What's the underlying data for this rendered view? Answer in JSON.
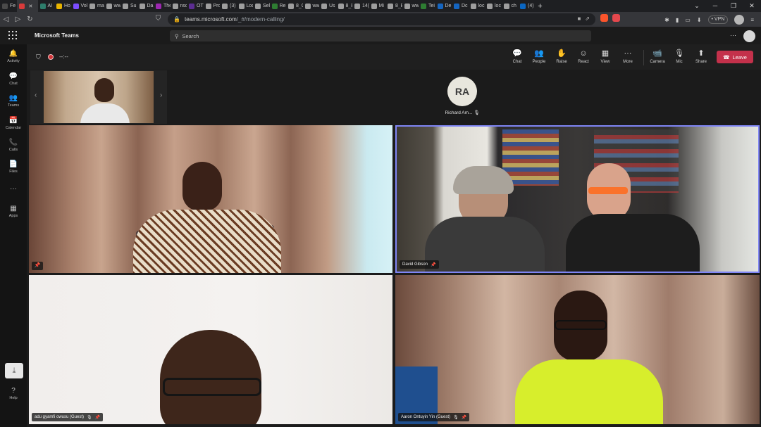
{
  "browser": {
    "tabs": [
      {
        "label": "Fe",
        "color": "#4a4a4a"
      },
      {
        "label": "",
        "color": "#d83b3b",
        "active": true
      },
      {
        "label": "AI",
        "color": "#2e7d6b"
      },
      {
        "label": "Ho",
        "color": "#e8b400"
      },
      {
        "label": "Vol",
        "color": "#7c4dff"
      },
      {
        "label": "ma",
        "color": "#9e9e9e"
      },
      {
        "label": "ww",
        "color": "#9e9e9e"
      },
      {
        "label": "Su",
        "color": "#9e9e9e"
      },
      {
        "label": "Da",
        "color": "#9e9e9e"
      },
      {
        "label": "The",
        "color": "#9c27b0"
      },
      {
        "label": "nsc",
        "color": "#9e9e9e"
      },
      {
        "label": "OT",
        "color": "#5c2d91"
      },
      {
        "label": "Pro",
        "color": "#9e9e9e"
      },
      {
        "label": "(3)",
        "color": "#9e9e9e"
      },
      {
        "label": "Loc",
        "color": "#9e9e9e"
      },
      {
        "label": "Sel",
        "color": "#9e9e9e"
      },
      {
        "label": "Rel",
        "color": "#2e7d32"
      },
      {
        "label": "8_C",
        "color": "#9e9e9e"
      },
      {
        "label": "ww",
        "color": "#9e9e9e"
      },
      {
        "label": "Us",
        "color": "#9e9e9e"
      },
      {
        "label": "8_E",
        "color": "#9e9e9e"
      },
      {
        "label": "14(",
        "color": "#9e9e9e"
      },
      {
        "label": "Mi",
        "color": "#9e9e9e"
      },
      {
        "label": "8_E",
        "color": "#9e9e9e"
      },
      {
        "label": "ww",
        "color": "#9e9e9e"
      },
      {
        "label": "Tei",
        "color": "#2e7d32"
      },
      {
        "label": "De",
        "color": "#1565c0"
      },
      {
        "label": "Dc",
        "color": "#1565c0"
      },
      {
        "label": "loc",
        "color": "#9e9e9e"
      },
      {
        "label": "loc",
        "color": "#9e9e9e"
      },
      {
        "label": "ch",
        "color": "#9e9e9e"
      },
      {
        "label": "(4)",
        "color": "#0a66c2"
      }
    ],
    "new_tab": "+",
    "window_controls": [
      "⌄",
      "─",
      "❐",
      "✕"
    ],
    "url_host": "teams.microsoft.com",
    "url_path": "/_#/modern-calling/",
    "vpn_label": "• VPN"
  },
  "teams": {
    "app_name": "Microsoft Teams",
    "search_placeholder": "Search",
    "more": "···"
  },
  "rail": [
    {
      "name": "activity",
      "icon": "🔔",
      "label": "Activity"
    },
    {
      "name": "chat",
      "icon": "💬",
      "label": "Chat"
    },
    {
      "name": "teams",
      "icon": "👥",
      "label": "Teams"
    },
    {
      "name": "calendar",
      "icon": "📅",
      "label": "Calendar"
    },
    {
      "name": "calls",
      "icon": "📞",
      "label": "Calls"
    },
    {
      "name": "files",
      "icon": "📄",
      "label": "Files"
    },
    {
      "name": "more",
      "icon": "···",
      "label": ""
    },
    {
      "name": "apps",
      "icon": "▦",
      "label": "Apps"
    },
    {
      "name": "help",
      "icon": "?",
      "label": "Help"
    }
  ],
  "meeting": {
    "timer": "--:--",
    "toolbar": [
      {
        "name": "chat",
        "icon": "💬",
        "label": "Chat"
      },
      {
        "name": "people",
        "icon": "👥",
        "label": "People"
      },
      {
        "name": "raise",
        "icon": "✋",
        "label": "Raise"
      },
      {
        "name": "react",
        "icon": "☺",
        "label": "React"
      },
      {
        "name": "view",
        "icon": "▦",
        "label": "View"
      },
      {
        "name": "more",
        "icon": "···",
        "label": "More"
      },
      {
        "name": "camera",
        "icon": "📹",
        "label": "Camera"
      },
      {
        "name": "mic",
        "icon": "🎙",
        "label": "Mic"
      },
      {
        "name": "share",
        "icon": "⬆",
        "label": "Share"
      }
    ],
    "leave_label": "Leave"
  },
  "participants": {
    "audio_only": {
      "initials": "RA",
      "name": "Richard Am..."
    },
    "tiles": [
      {
        "name": ""
      },
      {
        "name": "David Gibson"
      },
      {
        "name": "adu gyamfi owusu (Guest)"
      },
      {
        "name": "Aaron Ontuyin Yin (Guest)"
      }
    ]
  },
  "colors": {
    "leave": "#c4314b",
    "active_speaker_border": "#7f85f5",
    "recording": "#d13438"
  }
}
